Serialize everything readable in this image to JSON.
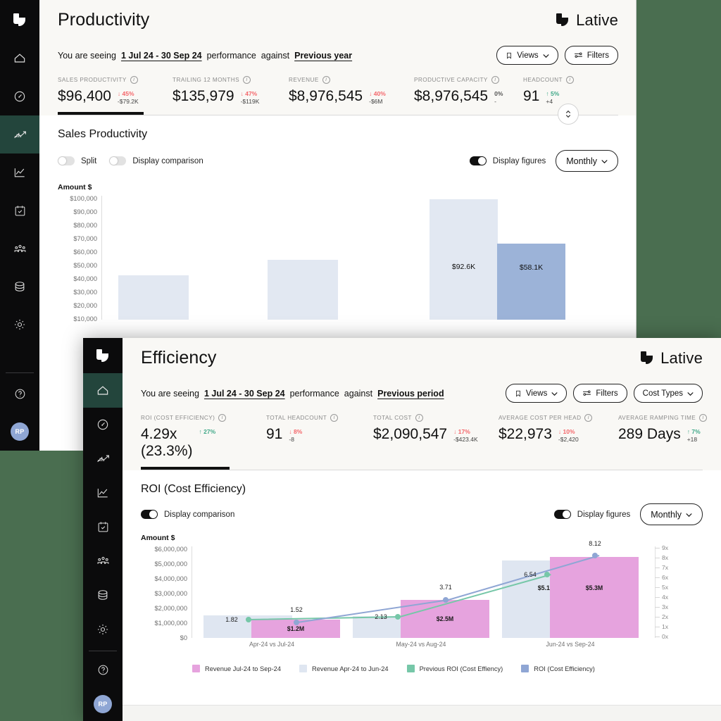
{
  "desktop": {
    "background": "#4a6e50"
  },
  "brand": {
    "name": "Lative",
    "logo_icon": "lative-logo-icon"
  },
  "sidebar": {
    "items": [
      {
        "icon": "home-icon",
        "name": "home"
      },
      {
        "icon": "gauge-icon",
        "name": "performance"
      },
      {
        "icon": "productivity-icon",
        "name": "productivity"
      },
      {
        "icon": "line-chart-icon",
        "name": "analytics"
      },
      {
        "icon": "calendar-check-icon",
        "name": "planning"
      },
      {
        "icon": "people-icon",
        "name": "team"
      },
      {
        "icon": "database-icon",
        "name": "data"
      },
      {
        "icon": "gear-icon",
        "name": "settings"
      }
    ],
    "help": {
      "icon": "help-circle-icon",
      "name": "help"
    },
    "avatar": {
      "initials": "RP",
      "color": "#8fa6d4"
    }
  },
  "window_productivity": {
    "title": "Productivity",
    "seeing": {
      "prefix": "You are seeing",
      "range": "1 Jul 24 - 30 Sep 24",
      "middle": "performance",
      "against": "against",
      "comparison": "Previous year"
    },
    "buttons": [
      {
        "label": "Views",
        "icon": "bookmark-icon",
        "chevron": "⌄"
      },
      {
        "label": "Filters",
        "icon": "filters-icon"
      }
    ],
    "kpis": [
      {
        "label": "SALES PRODUCTIVITY",
        "value": "$96,400",
        "pct": "45%",
        "arrow": "↓",
        "dir": "dn",
        "sub": "-$79.2K",
        "active": true
      },
      {
        "label": "TRAILING 12 MONTHS",
        "value": "$135,979",
        "pct": "47%",
        "arrow": "↓",
        "dir": "dn",
        "sub": "-$119K",
        "active": false
      },
      {
        "label": "REVENUE",
        "value": "$8,976,545",
        "pct": "40%",
        "arrow": "↓",
        "dir": "dn",
        "sub": "-$6M",
        "active": false
      },
      {
        "label": "PRODUCTIVE CAPACITY",
        "value": "$8,976,545",
        "pct": "0%",
        "arrow": "",
        "dir": "flat",
        "sub": "-",
        "active": false
      },
      {
        "label": "HEADCOUNT",
        "value": "91",
        "pct": "5%",
        "arrow": "↑",
        "dir": "up",
        "sub": "+4",
        "active": false
      }
    ],
    "panel": {
      "title": "Sales Productivity",
      "toggles": [
        {
          "label": "Split",
          "on": false
        },
        {
          "label": "Display comparison",
          "on": false
        },
        {
          "label": "Display figures",
          "on": true
        }
      ],
      "granularity": "Monthly"
    },
    "chart_data": {
      "type": "bar",
      "title": "Sales Productivity",
      "ylabel": "Amount $",
      "ylim": [
        0,
        100000
      ],
      "ytick_labels": [
        "$100,000",
        "$90,000",
        "$80,000",
        "$70,000",
        "$60,000",
        "$50,000",
        "$40,000",
        "$30,000",
        "$20,000",
        "$10,000"
      ],
      "ytick_values": [
        100000,
        90000,
        80000,
        70000,
        60000,
        50000,
        40000,
        30000,
        20000,
        10000
      ],
      "grid": false,
      "legend_position": "none",
      "bars": [
        {
          "value": 34000,
          "label": "",
          "color": "#e2e8f2"
        },
        {
          "value": 46000,
          "label": "",
          "color": "#e2e8f2"
        },
        {
          "value": 92600,
          "label": "$92.6K",
          "color": "#e2e8f2"
        },
        {
          "value": 58100,
          "label": "$58.1K",
          "color": "#9cb3d8"
        }
      ]
    }
  },
  "window_efficiency": {
    "title": "Efficiency",
    "seeing": {
      "prefix": "You are seeing",
      "range": "1 Jul 24 - 30 Sep 24",
      "middle": "performance",
      "against": "against",
      "comparison": "Previous period"
    },
    "buttons": [
      {
        "label": "Views",
        "icon": "bookmark-icon",
        "chevron": "⌄"
      },
      {
        "label": "Filters",
        "icon": "filters-icon"
      },
      {
        "label": "Cost Types",
        "icon": "",
        "chevron": "⌄"
      }
    ],
    "kpis": [
      {
        "label": "ROI (COST EFFICIENCY)",
        "value": "4.29x\n(23.3%)",
        "pct": "27%",
        "arrow": "↑",
        "dir": "up",
        "sub": "",
        "active": true
      },
      {
        "label": "TOTAL HEADCOUNT",
        "value": "91",
        "pct": "8%",
        "arrow": "↓",
        "dir": "dn",
        "sub": "-8",
        "active": false
      },
      {
        "label": "TOTAL COST",
        "value": "$2,090,547",
        "pct": "17%",
        "arrow": "↓",
        "dir": "dn",
        "sub": "-$423.4K",
        "active": false
      },
      {
        "label": "AVERAGE COST PER HEAD",
        "value": "$22,973",
        "pct": "10%",
        "arrow": "↓",
        "dir": "dn",
        "sub": "-$2,420",
        "active": false
      },
      {
        "label": "AVERAGE RAMPING TIME",
        "value": "289 Days",
        "pct": "7%",
        "arrow": "↑",
        "dir": "up",
        "sub": "+18",
        "active": false
      }
    ],
    "panel": {
      "title": "ROI (Cost Efficiency)",
      "toggles": [
        {
          "label": "Display comparison",
          "on": true
        },
        {
          "label": "Display figures",
          "on": true
        }
      ],
      "granularity": "Monthly"
    },
    "chart_data": {
      "type": "bar",
      "title": "ROI (Cost Efficiency)",
      "ylabel": "Amount $",
      "xlabel": "",
      "categories": [
        "Apr-24 vs Jul-24",
        "May-24 vs Aug-24",
        "Jun-24 vs Sep-24"
      ],
      "ylim": [
        0,
        6000000
      ],
      "ytick_labels": [
        "$6,000,000",
        "$5,000,000",
        "$4,000,000",
        "$3,000,000",
        "$2,000,000",
        "$1,000,000",
        "$0"
      ],
      "ytick_values": [
        6000000,
        5000000,
        4000000,
        3000000,
        2000000,
        1000000,
        0
      ],
      "right_axis_labels": [
        "9x",
        "8x",
        "7x",
        "6x",
        "5x",
        "4x",
        "3x",
        "2x",
        "1x",
        "0x"
      ],
      "right_ylim": [
        0,
        9
      ],
      "grid": false,
      "legend_position": "bottom",
      "series": [
        {
          "name": "Revenue Apr-24 to Jun-24",
          "type": "bar",
          "color": "#dfe6f1",
          "values": [
            1500000,
            1450000,
            5100000
          ],
          "labels": [
            "",
            "",
            "$5.1M"
          ]
        },
        {
          "name": "Revenue Jul-24 to Sep-24",
          "type": "bar",
          "color": "#e6a3de",
          "values": [
            1200000,
            2500000,
            5300000
          ],
          "labels": [
            "$1.2M",
            "$2.5M",
            "$5.3M"
          ]
        },
        {
          "name": "Previous ROI (Cost Effiency)",
          "type": "line",
          "color": "#76c7a8",
          "values": [
            1.82,
            2.13,
            6.54
          ],
          "labels": [
            "1.82",
            "2.13",
            "6.54"
          ]
        },
        {
          "name": "ROI (Cost Efficiency)",
          "type": "line",
          "color": "#8fa6d4",
          "values": [
            1.52,
            3.71,
            8.12
          ],
          "labels": [
            "1.52",
            "3.71",
            "8.12"
          ]
        }
      ],
      "legend": [
        {
          "label": "Revenue Jul-24 to Sep-24",
          "color": "#e6a3de"
        },
        {
          "label": "Revenue Apr-24 to Jun-24",
          "color": "#dfe6f1"
        },
        {
          "label": "Previous ROI (Cost Effiency)",
          "color": "#76c7a8"
        },
        {
          "label": "ROI (Cost Efficiency)",
          "color": "#8fa6d4"
        }
      ]
    }
  }
}
